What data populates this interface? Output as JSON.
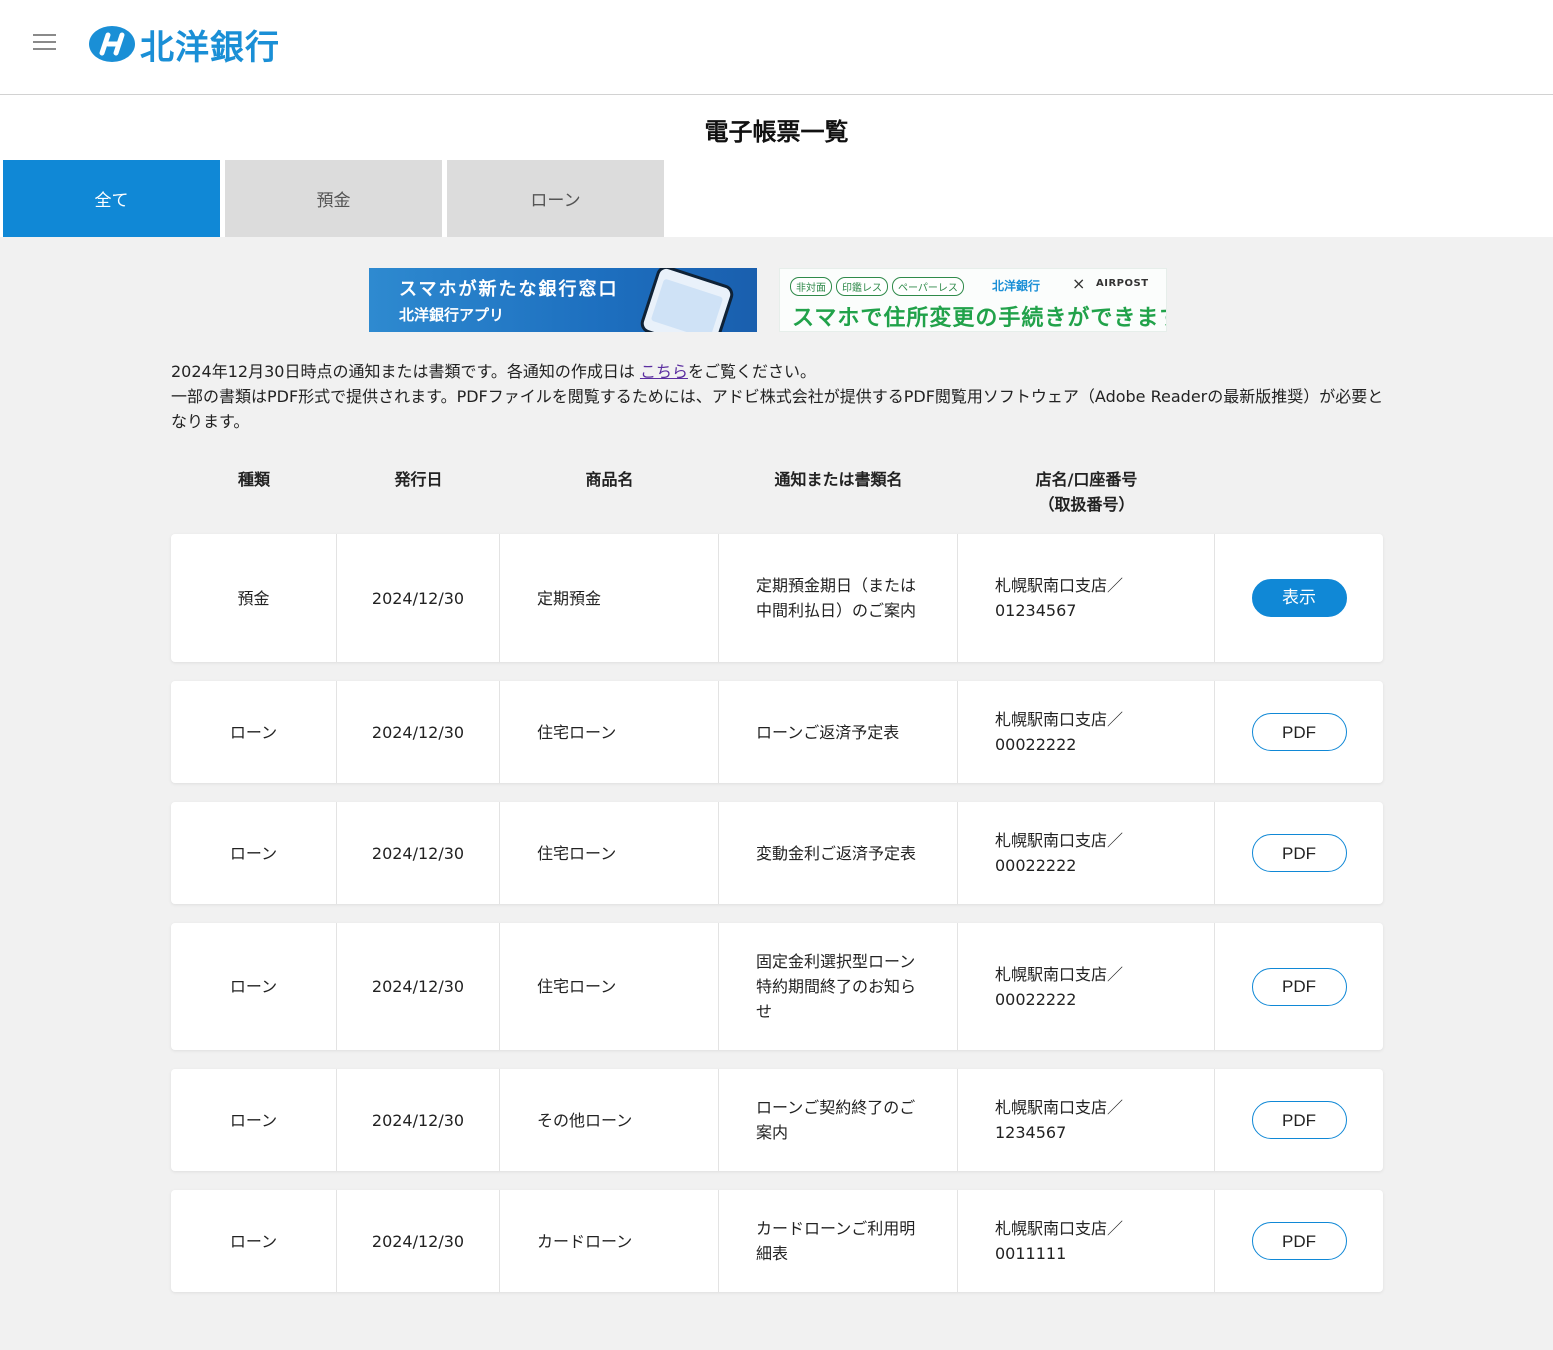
{
  "header": {
    "bank_name": "北洋銀行",
    "brand_color": "#1088d6"
  },
  "page_title": "電子帳票一覧",
  "tabs": [
    {
      "label": "全て",
      "active": true
    },
    {
      "label": "預金",
      "active": false
    },
    {
      "label": "ローン",
      "active": false
    }
  ],
  "banners": {
    "app": {
      "line1": "スマホが新たな銀行窓口",
      "line2": "北洋銀行アプリ"
    },
    "airpost": {
      "tags": [
        "非対面",
        "印鑑レス",
        "ペーパーレス"
      ],
      "bank": "北洋銀行",
      "x": "×",
      "partner": "AIRPOST",
      "main": "スマホで住所変更の手続きができます！"
    }
  },
  "info": {
    "line1_before_link": "2024年12月30日時点の通知または書類です。各通知の作成日は",
    "link_text": "こちら",
    "line1_after_link": "をご覧ください。",
    "line2": "一部の書類はPDF形式で提供されます。PDFファイルを閲覧するためには、アドビ株式会社が提供するPDF閲覧用ソフトウェア（Adobe Readerの最新版推奨）が必要となります。"
  },
  "table": {
    "headers": {
      "type": "種類",
      "date": "発行日",
      "product": "商品名",
      "document": "通知または書類名",
      "branch_line1": "店名/口座番号",
      "branch_line2": "（取扱番号）"
    },
    "rows": [
      {
        "type": "預金",
        "date": "2024/12/30",
        "product": "定期預金",
        "document": "定期預金期日（または中間利払日）のご案内",
        "branch": "札幌駅南口支店／",
        "account": "01234567",
        "button": "表示"
      },
      {
        "type": "ローン",
        "date": "2024/12/30",
        "product": "住宅ローン",
        "document": "ローンご返済予定表",
        "branch": "札幌駅南口支店／",
        "account": "00022222",
        "button": "PDF"
      },
      {
        "type": "ローン",
        "date": "2024/12/30",
        "product": "住宅ローン",
        "document": "変動金利ご返済予定表",
        "branch": "札幌駅南口支店／",
        "account": "00022222",
        "button": "PDF"
      },
      {
        "type": "ローン",
        "date": "2024/12/30",
        "product": "住宅ローン",
        "document": "固定金利選択型ローン特約期間終了のお知らせ",
        "branch": "札幌駅南口支店／",
        "account": "00022222",
        "button": "PDF"
      },
      {
        "type": "ローン",
        "date": "2024/12/30",
        "product": "その他ローン",
        "document": "ローンご契約終了のご案内",
        "branch": "札幌駅南口支店／",
        "account": "1234567",
        "button": "PDF"
      },
      {
        "type": "ローン",
        "date": "2024/12/30",
        "product": "カードローン",
        "document": "カードローンご利用明細表",
        "branch": "札幌駅南口支店／",
        "account": "0011111",
        "button": "PDF"
      }
    ]
  }
}
